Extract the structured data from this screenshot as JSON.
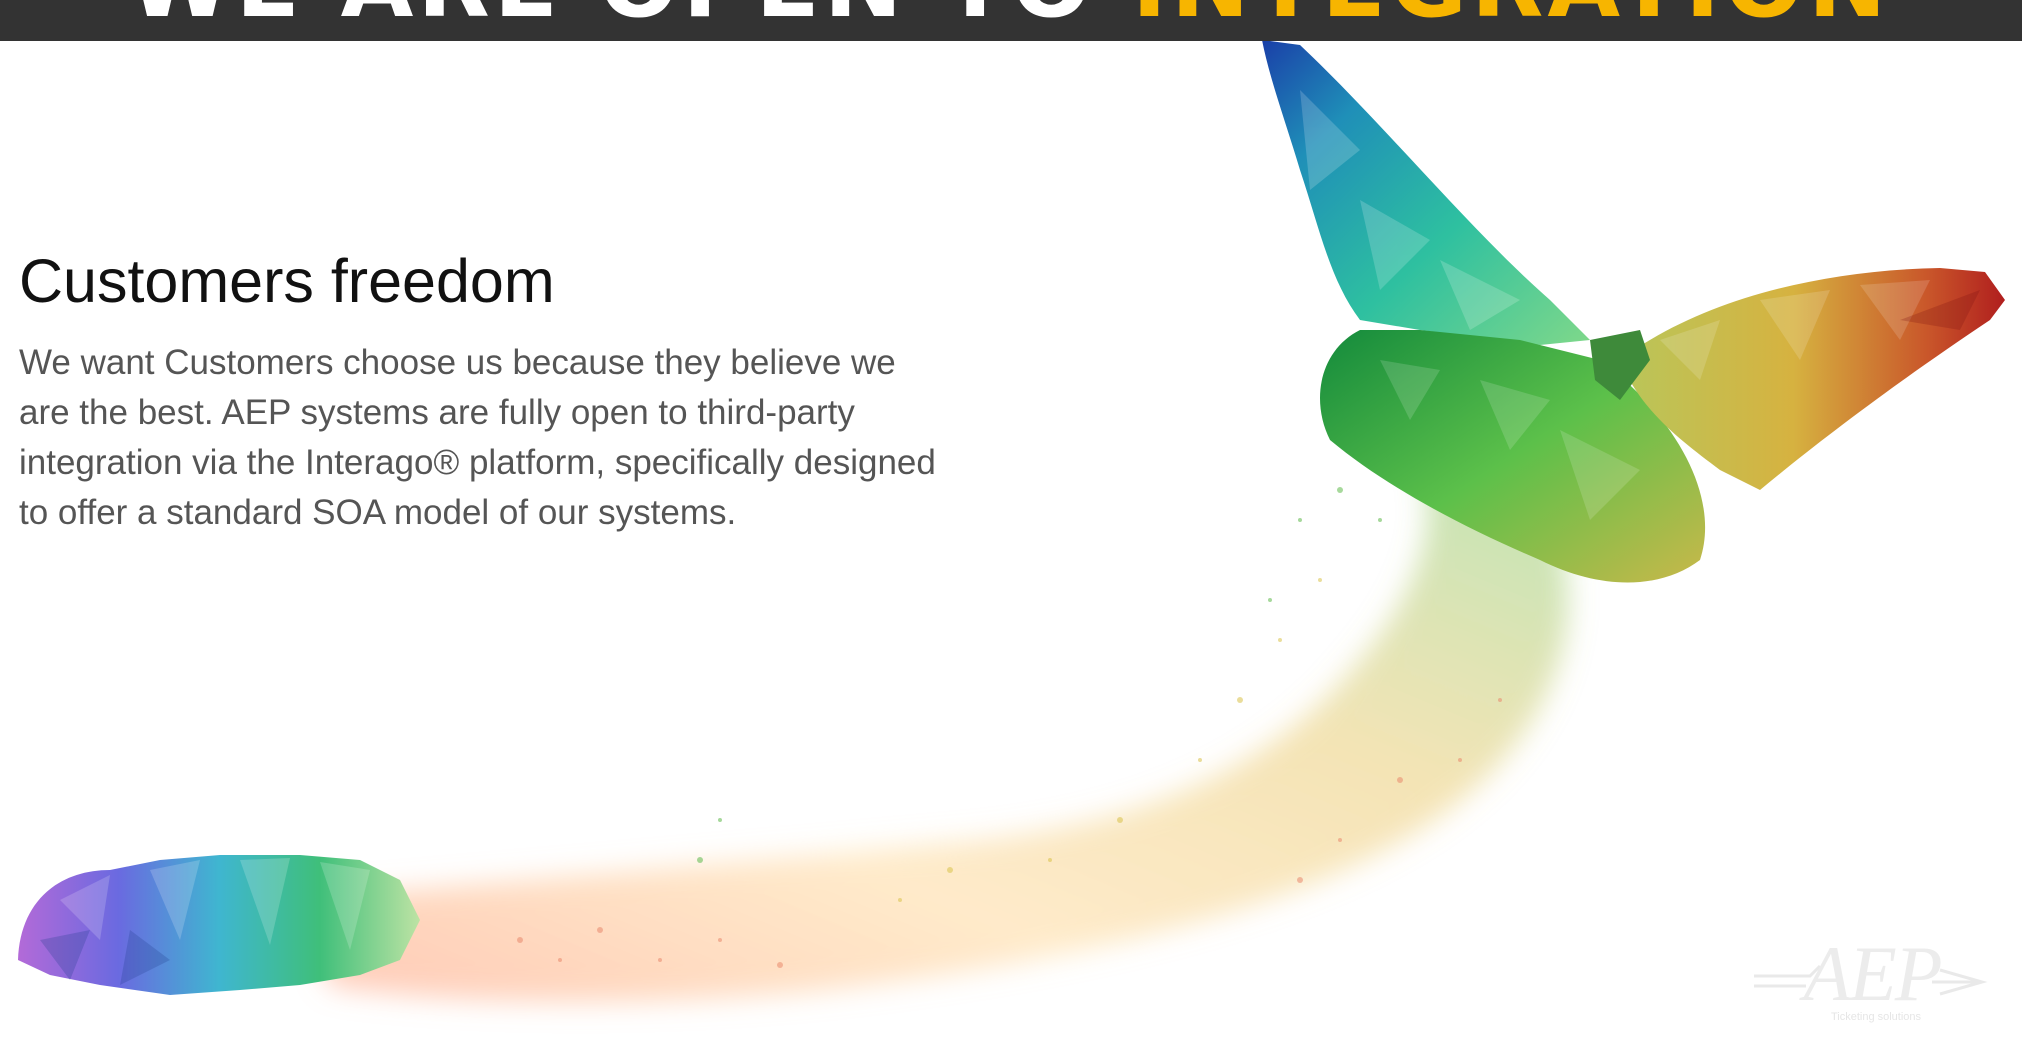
{
  "banner": {
    "heading_white": "WE ARE OPEN TO ",
    "heading_accent": "INTEGRATION",
    "background_color": "#333333",
    "accent_color": "#f7b500"
  },
  "main": {
    "title": "Customers freedom",
    "body": "We want Customers choose us because they believe we are the best. AEP systems are fully open to third-party integration via the Interago® platform, specifically designed to offer a standard SOA model of our systems."
  },
  "illustration": {
    "icon": "butterfly-caterpillar-icon"
  },
  "logo": {
    "text": "AEP",
    "tagline": "Ticketing solutions",
    "icon": "aep-logo-icon"
  }
}
